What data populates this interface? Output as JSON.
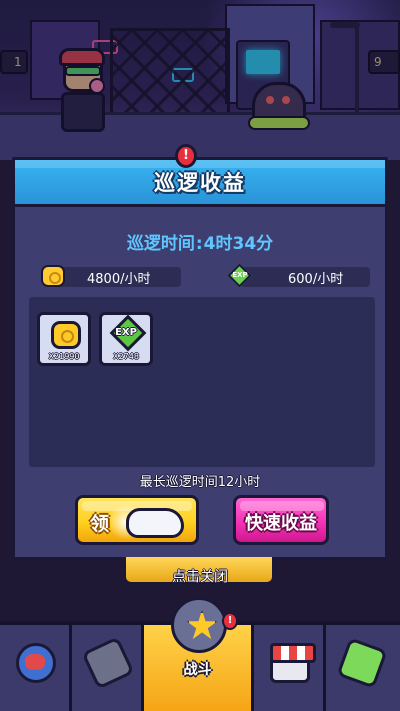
{
  "hud": {
    "left_value": "1",
    "right_value": "9"
  },
  "modal": {
    "title": "巡逻收益",
    "patrol_time_label": "巡逻时间",
    "patrol_time_sep": ":",
    "patrol_time_value": "4时34分",
    "gold_rate": "4800/小时",
    "exp_rate": "600/小时",
    "exp_icon_text": "EXP",
    "rewards": [
      {
        "icon": "gold-coin-icon",
        "quantity": "X21990"
      },
      {
        "icon": "exp-gem-icon",
        "label": "EXP",
        "quantity": "X2748"
      }
    ],
    "max_time_note": "最长巡逻时间12小时",
    "claim_button_label": "领",
    "fast_income_button_label": "快速收益",
    "alert_mark": "!"
  },
  "close": {
    "label": "点击关闭"
  },
  "nav": {
    "items": [
      {
        "icon": "globe-icon"
      },
      {
        "icon": "gun-icon"
      },
      {
        "icon": "battle-emblem-icon",
        "label": "战斗",
        "active": true
      },
      {
        "icon": "shop-icon"
      },
      {
        "icon": "energy-can-icon"
      }
    ],
    "badge": "!"
  },
  "colors": {
    "header_blue": "#2a93d8",
    "patrol_time_text": "#5fc6ff",
    "claim_button": "#ffd020",
    "fast_button": "#f22fb2",
    "panel_bg": "#3e3f70"
  }
}
